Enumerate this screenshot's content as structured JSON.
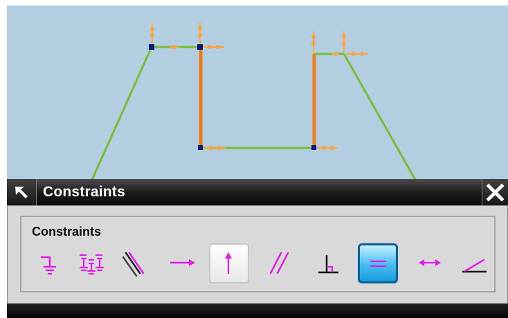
{
  "dialog": {
    "title": "Constraints",
    "group_title": "Constraints"
  },
  "toolbar": {
    "tools": [
      {
        "name": "fixed-constraint",
        "selected": false
      },
      {
        "name": "fully-fixed-constraint",
        "selected": false
      },
      {
        "name": "collinear-constraint",
        "selected": false
      },
      {
        "name": "horizontal-constraint",
        "selected": false
      },
      {
        "name": "vertical-constraint",
        "selected": true,
        "style": "white-highlight"
      },
      {
        "name": "parallel-constraint",
        "selected": false
      },
      {
        "name": "perpendicular-constraint",
        "selected": false
      },
      {
        "name": "equal-length-constraint",
        "selected": true,
        "style": "blue-highlight"
      },
      {
        "name": "constant-length-constraint",
        "selected": false
      },
      {
        "name": "constant-angle-constraint",
        "selected": false
      }
    ]
  },
  "colors": {
    "canvas": "#b3cde1",
    "sketch_line": "#78bd32",
    "selected_line": "#ef7d17",
    "constraint_symbol": "#ffa53c",
    "vertex": "#07177c",
    "dialog_dark": "#111111",
    "tool_magenta": "#e11ce7"
  }
}
